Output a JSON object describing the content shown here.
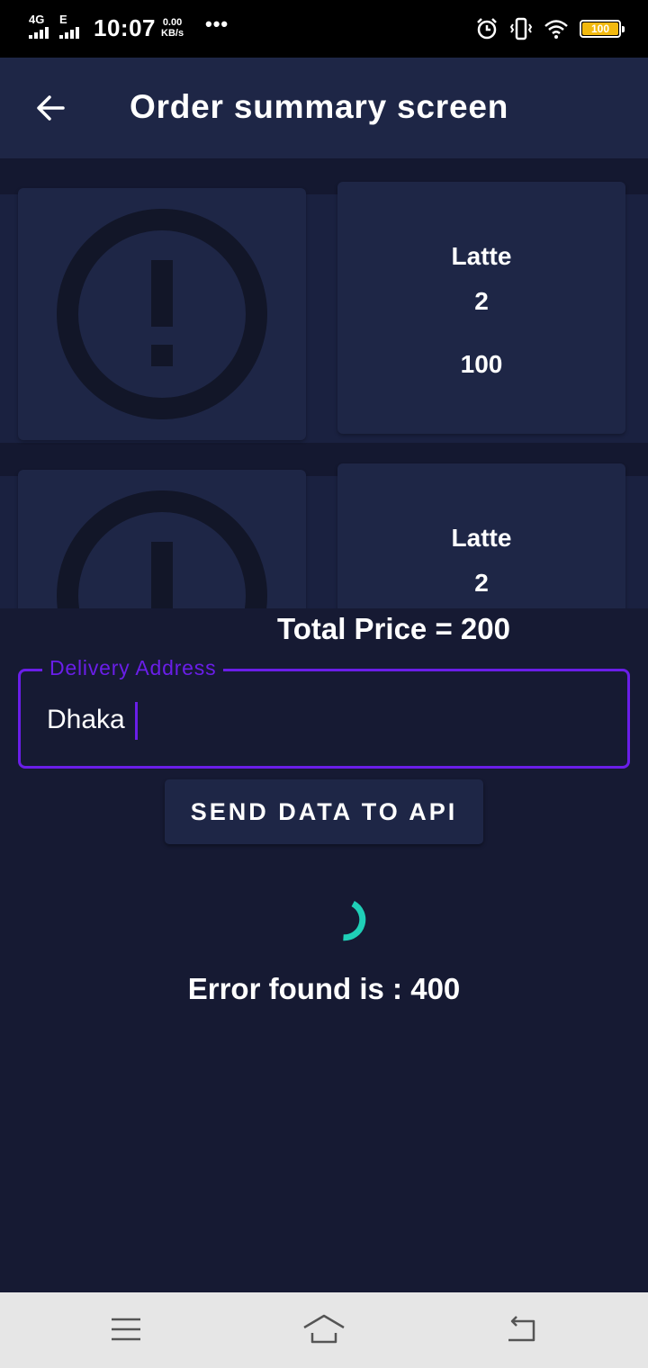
{
  "status_bar": {
    "network_top": "4G",
    "network_bottom": "E",
    "time": "10:07",
    "speed_value": "0.00",
    "speed_unit": "KB/s",
    "more": "•••",
    "battery": "100",
    "battery_color": "#f2b90f"
  },
  "app_bar": {
    "title": "Order summary screen",
    "background": "#1e2646"
  },
  "orders": [
    {
      "name": "Latte",
      "quantity": "2",
      "price": "100",
      "image_icon": "error-icon"
    },
    {
      "name": "Latte",
      "quantity": "2",
      "image_icon": "error-icon"
    }
  ],
  "total_price": "Total Price = 200",
  "delivery": {
    "label": "Delivery Address",
    "value": "Dhaka",
    "accent": "#6a1ee8"
  },
  "send_button": {
    "label": "SEND DATA TO API"
  },
  "spinner_color": "#1fcfb7",
  "error_message": "Error found is : 400",
  "nav_bar": {
    "menu_icon": "menu-icon",
    "home_icon": "home-icon",
    "back_icon": "back-icon"
  }
}
